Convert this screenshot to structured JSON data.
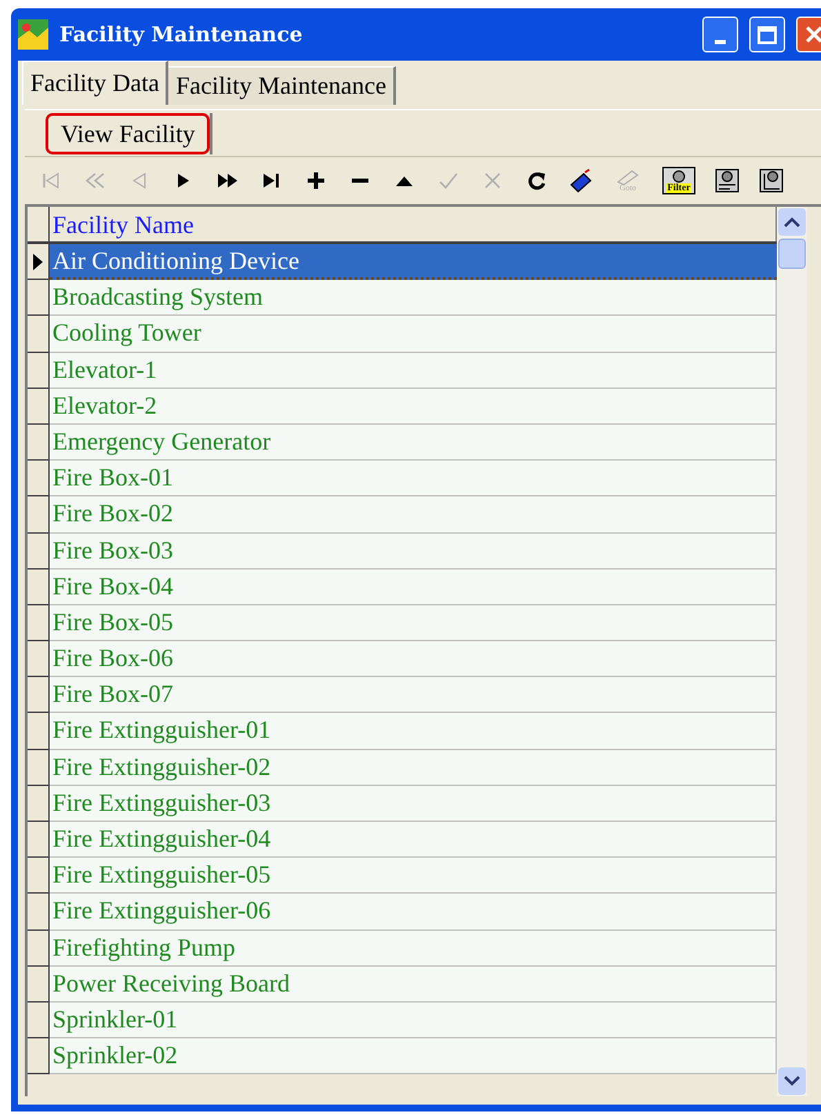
{
  "window": {
    "title": "Facility Maintenance"
  },
  "tabs": [
    {
      "label": "Facility Data",
      "selected": true
    },
    {
      "label": "Facility Maintenance",
      "selected": false
    }
  ],
  "subtabs": [
    {
      "label": "View Facility",
      "selected": true
    }
  ],
  "toolbar": [
    {
      "kind": "first",
      "disabled": true
    },
    {
      "kind": "prior",
      "disabled": true
    },
    {
      "kind": "prev",
      "disabled": true
    },
    {
      "kind": "next",
      "disabled": false
    },
    {
      "kind": "forward",
      "disabled": false
    },
    {
      "kind": "last",
      "disabled": false
    },
    {
      "kind": "add",
      "disabled": false
    },
    {
      "kind": "delete",
      "disabled": false
    },
    {
      "kind": "up",
      "disabled": false
    },
    {
      "kind": "post",
      "disabled": true
    },
    {
      "kind": "cancel",
      "disabled": true
    },
    {
      "kind": "refresh",
      "disabled": false
    },
    {
      "kind": "book",
      "disabled": false
    },
    {
      "kind": "goto",
      "label": "Goto",
      "disabled": true
    },
    {
      "kind": "filter",
      "label": "Filter",
      "disabled": false
    },
    {
      "kind": "report",
      "disabled": false
    },
    {
      "kind": "chart",
      "disabled": false
    }
  ],
  "table": {
    "columns": [
      "Facility Name"
    ],
    "rows": [
      {
        "name": "Air Conditioning Device",
        "selected": true
      },
      {
        "name": "Broadcasting System",
        "selected": false
      },
      {
        "name": "Cooling Tower",
        "selected": false
      },
      {
        "name": "Elevator-1",
        "selected": false
      },
      {
        "name": "Elevator-2",
        "selected": false
      },
      {
        "name": "Emergency Generator",
        "selected": false
      },
      {
        "name": "Fire Box-01",
        "selected": false
      },
      {
        "name": "Fire Box-02",
        "selected": false
      },
      {
        "name": "Fire Box-03",
        "selected": false
      },
      {
        "name": "Fire Box-04",
        "selected": false
      },
      {
        "name": "Fire Box-05",
        "selected": false
      },
      {
        "name": "Fire Box-06",
        "selected": false
      },
      {
        "name": "Fire Box-07",
        "selected": false
      },
      {
        "name": "Fire Extingguisher-01",
        "selected": false
      },
      {
        "name": "Fire Extingguisher-02",
        "selected": false
      },
      {
        "name": "Fire Extingguisher-03",
        "selected": false
      },
      {
        "name": "Fire Extingguisher-04",
        "selected": false
      },
      {
        "name": "Fire Extingguisher-05",
        "selected": false
      },
      {
        "name": "Fire Extingguisher-06",
        "selected": false
      },
      {
        "name": "Firefighting Pump",
        "selected": false
      },
      {
        "name": "Power Receiving Board",
        "selected": false
      },
      {
        "name": "Sprinkler-01",
        "selected": false
      },
      {
        "name": "Sprinkler-02",
        "selected": false
      }
    ]
  }
}
